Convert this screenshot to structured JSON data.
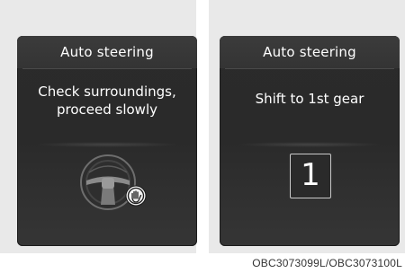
{
  "panels": [
    {
      "title": "Auto steering",
      "message_line1": "Check surroundings,",
      "message_line2": "proceed slowly",
      "icons": [
        "steering-wheel-icon",
        "hand-on-wheel-icon"
      ]
    },
    {
      "title": "Auto steering",
      "message_line1": "Shift to 1st gear",
      "gear_value": "1"
    }
  ],
  "caption": "OBC3073099L/OBC3073100L",
  "colors": {
    "panel_background": "#e9e9e9",
    "screen_background": "#2b2b2b",
    "text": "#ffffff"
  }
}
